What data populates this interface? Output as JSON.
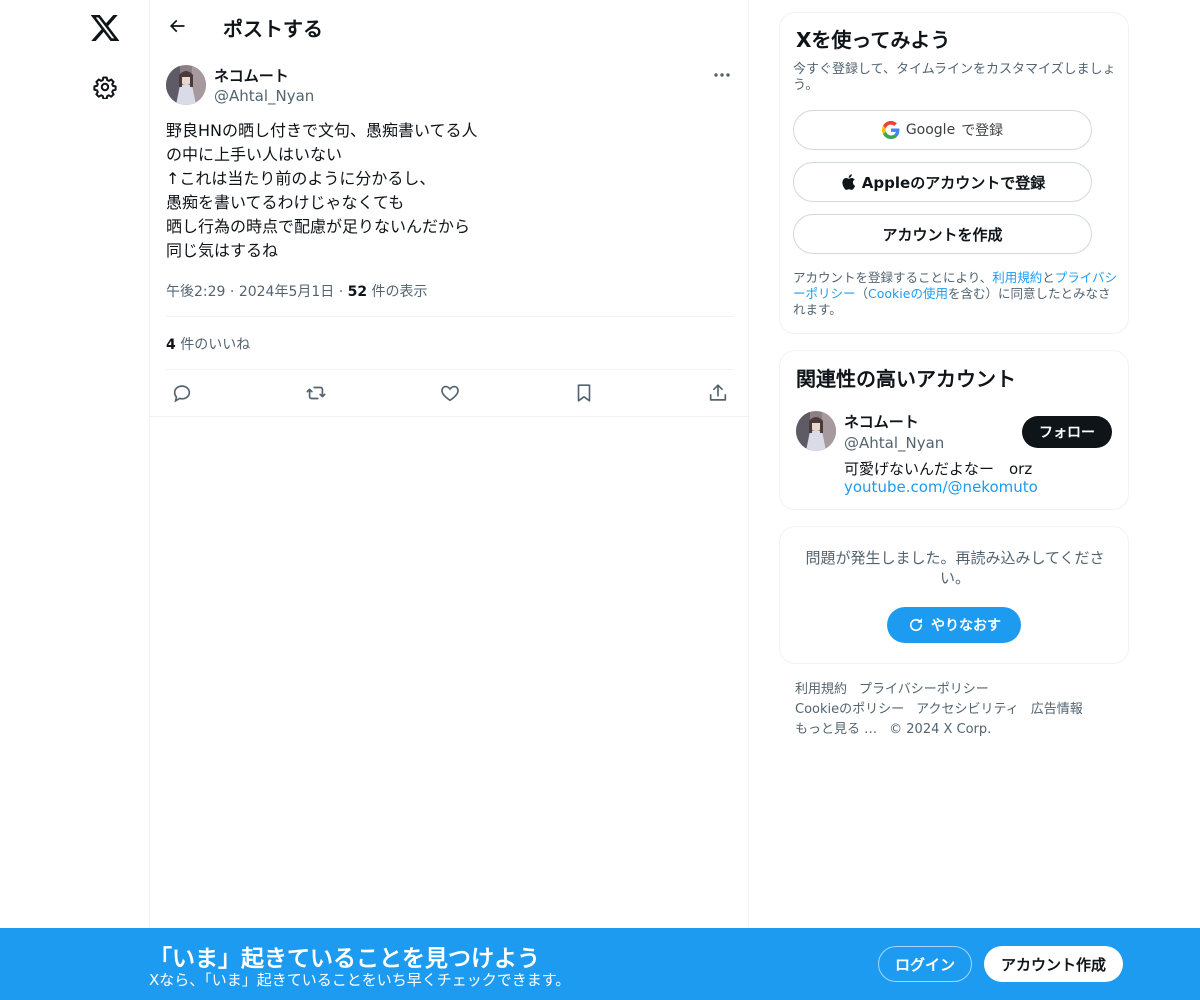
{
  "header": {
    "title": "ポストする"
  },
  "post": {
    "author_name": "ネコムート",
    "author_handle": "@Ahtal_Nyan",
    "lines": [
      "野良HNの晒し付きで文句、愚痴書いてる人",
      "の中に上手い人はいない",
      "↑これは当たり前のように分かるし、",
      "愚痴を書いてるわけじゃなくても",
      "晒し行為の時点で配慮が足りないんだから",
      "同じ気はするね"
    ],
    "time": "午後2:29",
    "date": "2024年5月1日",
    "views_count": "52",
    "views_label": " 件の表示",
    "likes_count": "4",
    "likes_label": " 件のいいね"
  },
  "signup_card": {
    "title": "Xを使ってみよう",
    "subtitle": "今すぐ登録して、タイムラインをカスタマイズしましょう。",
    "google_word": "Google",
    "google_suffix": " で登録",
    "apple_label": "Appleのアカウントで登録",
    "create_label": "アカウントを作成",
    "legal_1": "アカウントを登録することにより、",
    "legal_terms": "利用規約",
    "legal_2": "と",
    "legal_privacy": "プライバシーポリシー",
    "legal_3": "（",
    "legal_cookie": "Cookieの使用",
    "legal_4": "を含む）に同意したとみなされます。"
  },
  "recommend_card": {
    "title": "関連性の高いアカウント",
    "name": "ネコムート",
    "handle": "@Ahtal_Nyan",
    "bio": "可愛げないんだよなー　orz",
    "link": "youtube.com/@nekomuto",
    "follow_label": "フォロー"
  },
  "error_card": {
    "message": "問題が発生しました。再読み込みしてください。",
    "retry_label": "やりなおす"
  },
  "footer": {
    "links": [
      "利用規約",
      "プライバシーポリシー",
      "Cookieのポリシー",
      "アクセシビリティ",
      "広告情報",
      "もっと見る …",
      "© 2024 X Corp."
    ]
  },
  "banner": {
    "title": "「いま」起きていることを見つけよう",
    "subtitle": "Xなら、「いま」起きていることをいち早くチェックできます。",
    "login_label": "ログイン",
    "signup_label": "アカウント作成"
  },
  "colors": {
    "accent": "#1d9bf0",
    "text": "#0f1419",
    "muted": "#536471",
    "border": "#eff3f4"
  },
  "icons": [
    "x-logo-icon",
    "gear-icon",
    "back-arrow-icon",
    "more-icon",
    "reply-icon",
    "repost-icon",
    "like-icon",
    "bookmark-icon",
    "share-icon",
    "google-icon",
    "apple-icon",
    "refresh-icon"
  ]
}
